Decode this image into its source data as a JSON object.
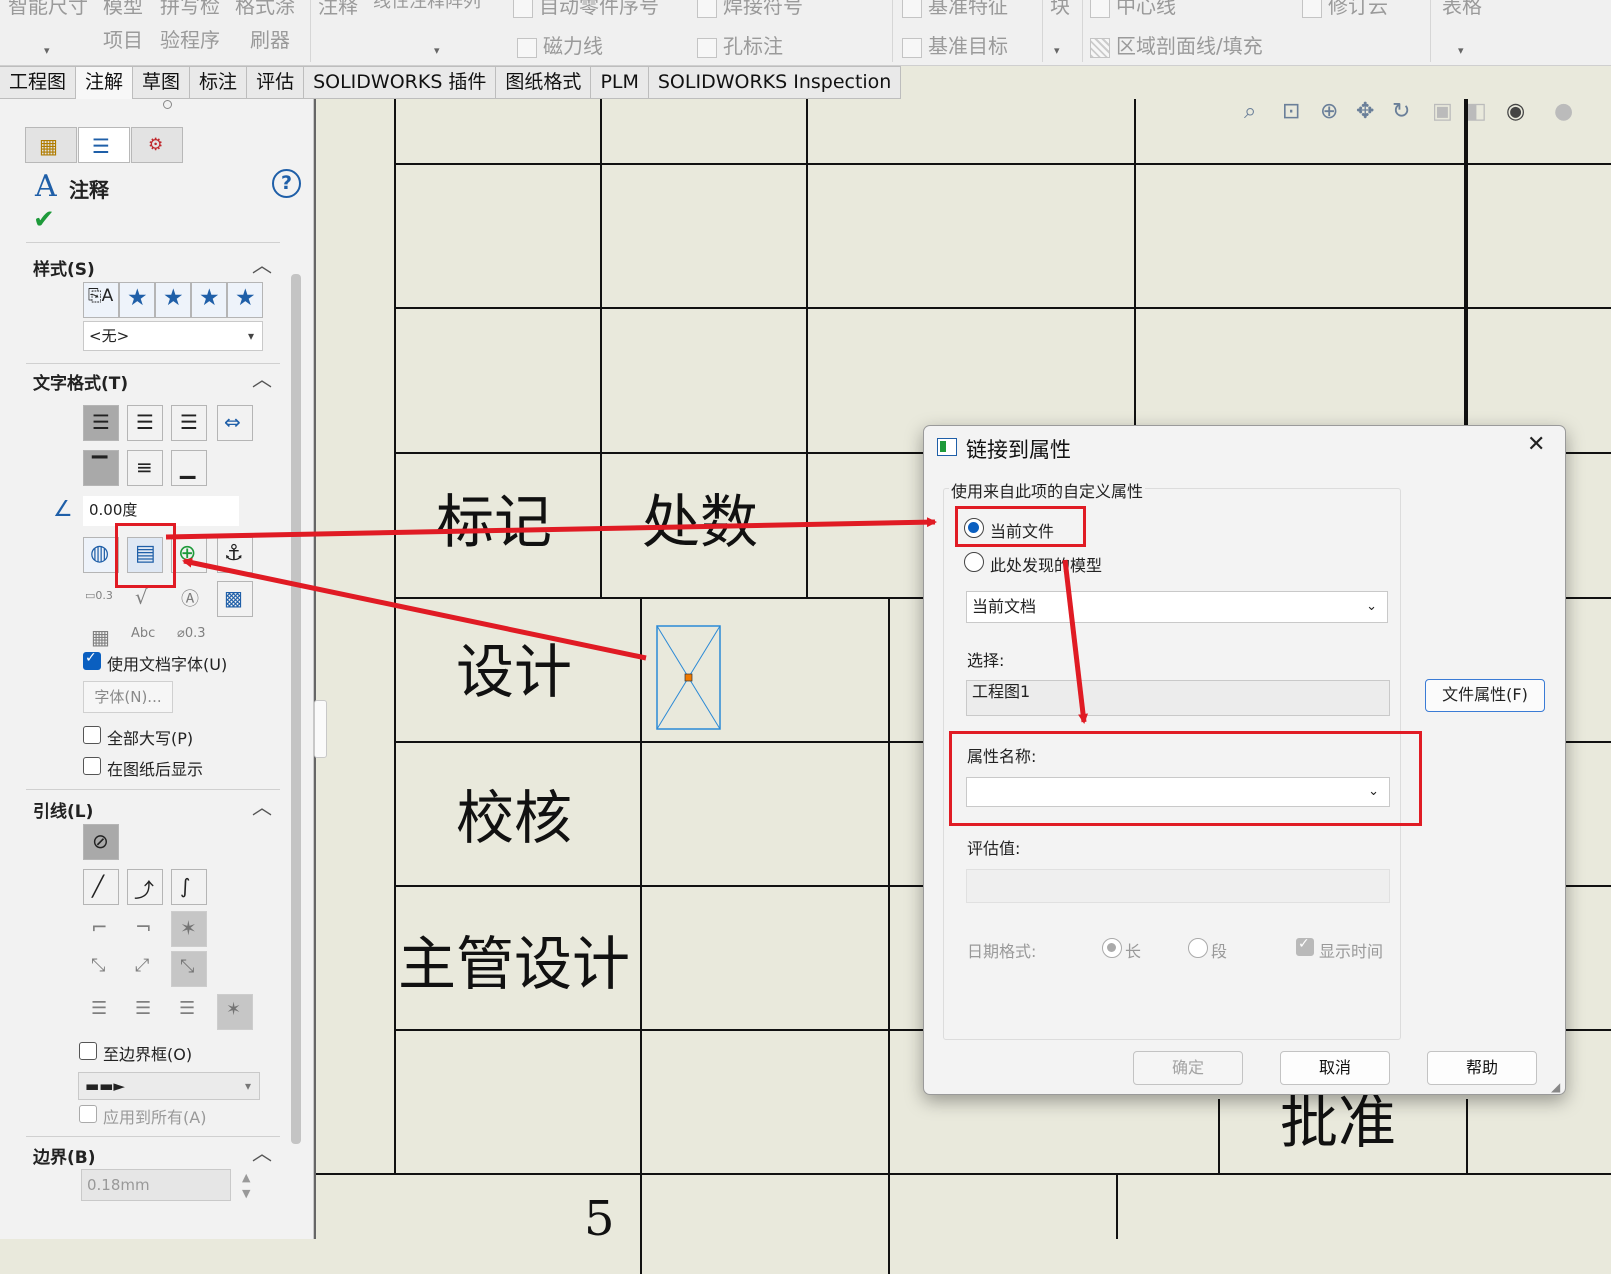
{
  "ribbon": {
    "items": [
      {
        "label": "智能尺寸"
      },
      {
        "label": "模型"
      },
      {
        "label": "项目"
      },
      {
        "label": "拼写检"
      },
      {
        "label": "验程序"
      },
      {
        "label": "格式涂"
      },
      {
        "label": "刷器"
      },
      {
        "label": "注释"
      },
      {
        "label": "线性注释阵列"
      },
      {
        "label": "自动零件序号"
      },
      {
        "label": "焊接符号"
      },
      {
        "label": "磁力线"
      },
      {
        "label": "孔标注"
      },
      {
        "label": "基准特征"
      },
      {
        "label": "基准目标"
      },
      {
        "label": "块"
      },
      {
        "label": "中心线"
      },
      {
        "label": "修订云"
      },
      {
        "label": "区域剖面线/填充"
      },
      {
        "label": "表格"
      }
    ]
  },
  "tabs": [
    {
      "label": "工程图"
    },
    {
      "label": "注解"
    },
    {
      "label": "草图"
    },
    {
      "label": "标注"
    },
    {
      "label": "评估"
    },
    {
      "label": "SOLIDWORKS 插件"
    },
    {
      "label": "图纸格式"
    },
    {
      "label": "PLM"
    },
    {
      "label": "SOLIDWORKS Inspection"
    }
  ],
  "panel": {
    "title": "注释",
    "help": "?",
    "style_section": "样式(S)",
    "style_select": "<无>",
    "text_format_section": "文字格式(T)",
    "angle_value": "0.00度",
    "use_doc_font": "使用文档字体(U)",
    "font_button": "字体(N)...",
    "all_caps": "全部大写(P)",
    "behind_sheet": "在图纸后显示",
    "leader_section": "引线(L)",
    "to_boundary": "至边界框(O)",
    "apply_all": "应用到所有(A)",
    "border_section": "边界(B)",
    "border_value": "0.18mm"
  },
  "drawing": {
    "cells": [
      {
        "text": "标记"
      },
      {
        "text": "处数"
      },
      {
        "text": "设计"
      },
      {
        "text": "校核"
      },
      {
        "text": "主管设计"
      },
      {
        "text": "批准"
      },
      {
        "text": "5"
      }
    ]
  },
  "dialog": {
    "title": "链接到属性",
    "close": "✕",
    "group_label": "使用来自此项的自定义属性",
    "radio_current": "当前文件",
    "radio_model": "此处发现的模型",
    "source_select": "当前文档",
    "select_label": "选择:",
    "select_value": "工程图1",
    "file_props_button": "文件属性(F)",
    "prop_name_label": "属性名称:",
    "prop_name_value": "",
    "eval_label": "评估值:",
    "date_format_label": "日期格式:",
    "date_long": "长",
    "date_short": "段",
    "show_time": "显示时间",
    "ok": "确定",
    "cancel": "取消",
    "help": "帮助"
  },
  "colors": {
    "annotation_red": "#e01b24",
    "accent_blue": "#0a5fc0",
    "sheet": "#e9e9dc"
  }
}
